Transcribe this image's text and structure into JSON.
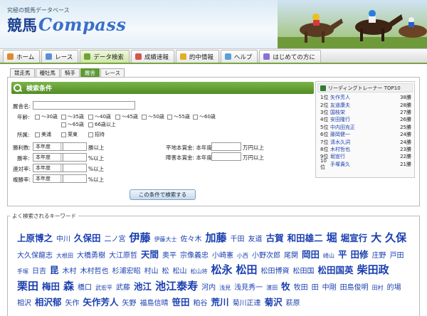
{
  "header": {
    "tagline": "究極の競馬データベース",
    "logo_jp": "競馬",
    "logo_en": "Compass"
  },
  "nav": [
    {
      "label": "ホーム",
      "icon": "house-icon",
      "color": "#e08a2b"
    },
    {
      "label": "レース",
      "icon": "flag-icon",
      "color": "#5a8fd6"
    },
    {
      "label": "データ検索",
      "icon": "search-icon",
      "color": "#6fa33a"
    },
    {
      "label": "成績速報",
      "icon": "chart-icon",
      "color": "#d9534f"
    },
    {
      "label": "的中情報",
      "icon": "target-icon",
      "color": "#e0b02b"
    },
    {
      "label": "ヘルプ",
      "icon": "help-icon",
      "color": "#5aa0d6"
    },
    {
      "label": "はじめての方に",
      "icon": "beginner-icon",
      "color": "#8a6fd6"
    }
  ],
  "subtabs": [
    "競走馬",
    "種牡馬",
    "騎手",
    "厩舎",
    "レース"
  ],
  "search": {
    "title": "検索条件",
    "name_label": "厩舎名:",
    "age_label": "年齢:",
    "ages": [
      "～30歳",
      "～35歳",
      "～40歳",
      "～45歳",
      "～50歳",
      "～55歳",
      "～60歳",
      "～65歳",
      "66歳以上"
    ],
    "affil_label": "所属:",
    "affils": [
      "美浦",
      "栗東",
      "招待"
    ],
    "rows": [
      {
        "label": "勝利数:",
        "select": "本年度",
        "unit": "勝以上"
      },
      {
        "label": "勝率:",
        "select": "本年度",
        "unit": "%以上"
      },
      {
        "label": "連対率:",
        "select": "本年度",
        "unit": "%以上"
      },
      {
        "label": "複勝率:",
        "select": "本年度",
        "unit": "%以上"
      }
    ],
    "money_rows": [
      {
        "label": "平地本賞金: 本年度",
        "unit": "万円以上"
      },
      {
        "label": "障害本賞金: 本年度",
        "unit": "万円以上"
      }
    ],
    "submit": "この条件で検索する"
  },
  "ranking": {
    "title": "リーディングトレーナー TOP10",
    "items": [
      {
        "rank": "1位",
        "name": "矢作芳人",
        "count": "38勝"
      },
      {
        "rank": "2位",
        "name": "友道康夫",
        "count": "28勝"
      },
      {
        "rank": "3位",
        "name": "国枝栄",
        "count": "27勝"
      },
      {
        "rank": "4位",
        "name": "安田隆行",
        "count": "26勝"
      },
      {
        "rank": "5位",
        "name": "中内田充正",
        "count": "25勝"
      },
      {
        "rank": "6位",
        "name": "藤岡健一",
        "count": "24勝"
      },
      {
        "rank": "7位",
        "name": "清水久詞",
        "count": "24勝"
      },
      {
        "rank": "8位",
        "name": "木村哲也",
        "count": "23勝"
      },
      {
        "rank": "9位",
        "name": "堀宣行",
        "count": "22勝"
      },
      {
        "rank": "10位",
        "name": "手塚貴久",
        "count": "21勝"
      }
    ]
  },
  "keywords": {
    "title": "よく検索されるキーワード",
    "items": [
      {
        "t": "上原博之",
        "s": 3
      },
      {
        "t": "中川",
        "s": 2
      },
      {
        "t": "久保田",
        "s": 3
      },
      {
        "t": "二ノ宮",
        "s": 2
      },
      {
        "t": "伊藤",
        "s": 4
      },
      {
        "t": "伊藤大士",
        "s": 1
      },
      {
        "t": "佐々木",
        "s": 2
      },
      {
        "t": "加藤",
        "s": 4
      },
      {
        "t": "千田",
        "s": 2
      },
      {
        "t": "友道",
        "s": 2
      },
      {
        "t": "古賀",
        "s": 3
      },
      {
        "t": "和田雄二",
        "s": 3
      },
      {
        "t": "堀",
        "s": 4
      },
      {
        "t": "堀宣行",
        "s": 3
      },
      {
        "t": "大",
        "s": 4
      },
      {
        "t": "久保",
        "s": 4
      },
      {
        "t": "大久保龍志",
        "s": 2
      },
      {
        "t": "大根田",
        "s": 1
      },
      {
        "t": "大橋勇樹",
        "s": 2
      },
      {
        "t": "大江原哲",
        "s": 2
      },
      {
        "t": "天間",
        "s": 3
      },
      {
        "t": "奥平",
        "s": 2
      },
      {
        "t": "宗像義忠",
        "s": 2
      },
      {
        "t": "小崎憲",
        "s": 2
      },
      {
        "t": "小西",
        "s": 1
      },
      {
        "t": "小野次郎",
        "s": 2
      },
      {
        "t": "尾関",
        "s": 2
      },
      {
        "t": "岡田",
        "s": 3
      },
      {
        "t": "崎山",
        "s": 1
      },
      {
        "t": "平",
        "s": 3
      },
      {
        "t": "田修",
        "s": 3
      },
      {
        "t": "庄野",
        "s": 2
      },
      {
        "t": "戸田",
        "s": 2
      },
      {
        "t": "手塚",
        "s": 1
      },
      {
        "t": "日吉",
        "s": 2
      },
      {
        "t": "昆",
        "s": 3
      },
      {
        "t": "木村",
        "s": 2
      },
      {
        "t": "木村哲也",
        "s": 2
      },
      {
        "t": "杉浦宏昭",
        "s": 2
      },
      {
        "t": "村山",
        "s": 2
      },
      {
        "t": "松",
        "s": 2
      },
      {
        "t": "松山",
        "s": 2
      },
      {
        "t": "松山将",
        "s": 1
      },
      {
        "t": "松永",
        "s": 4
      },
      {
        "t": "松田",
        "s": 4
      },
      {
        "t": "松田博資",
        "s": 2
      },
      {
        "t": "松田国",
        "s": 2
      },
      {
        "t": "松田国英",
        "s": 3
      },
      {
        "t": "柴田政",
        "s": 4
      },
      {
        "t": "栗田",
        "s": 4
      },
      {
        "t": "梅田",
        "s": 3
      },
      {
        "t": "森",
        "s": 4
      },
      {
        "t": "橋口",
        "s": 2
      },
      {
        "t": "武宏平",
        "s": 1
      },
      {
        "t": "武藤",
        "s": 2
      },
      {
        "t": "池江",
        "s": 3
      },
      {
        "t": "池江泰寿",
        "s": 4
      },
      {
        "t": "河内",
        "s": 2
      },
      {
        "t": "浅見",
        "s": 1
      },
      {
        "t": "浅見秀一",
        "s": 2
      },
      {
        "t": "濱田",
        "s": 1
      },
      {
        "t": "牧",
        "s": 3
      },
      {
        "t": "牧田",
        "s": 2
      },
      {
        "t": "田",
        "s": 2
      },
      {
        "t": "中剛",
        "s": 2
      },
      {
        "t": "田島俊明",
        "s": 2
      },
      {
        "t": "田村",
        "s": 1
      },
      {
        "t": "的場",
        "s": 2
      },
      {
        "t": "相沢",
        "s": 2
      },
      {
        "t": "相沢郁",
        "s": 3
      },
      {
        "t": "矢作",
        "s": 2
      },
      {
        "t": "矢作芳人",
        "s": 3
      },
      {
        "t": "矢野",
        "s": 2
      },
      {
        "t": "福島信晴",
        "s": 2
      },
      {
        "t": "笹田",
        "s": 3
      },
      {
        "t": "粕谷",
        "s": 2
      },
      {
        "t": "荒川",
        "s": 3
      },
      {
        "t": "菊川正達",
        "s": 2
      },
      {
        "t": "菊沢",
        "s": 3
      },
      {
        "t": "萩原",
        "s": 2
      }
    ]
  }
}
